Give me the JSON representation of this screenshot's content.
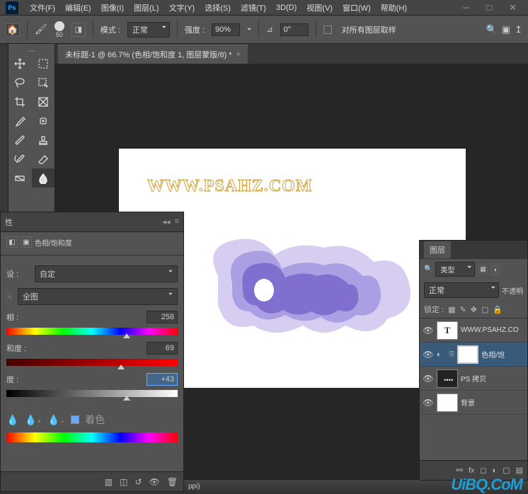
{
  "menu": {
    "file": "文件(F)",
    "edit": "编辑(E)",
    "image": "图像(I)",
    "layer": "图层(L)",
    "type": "文字(Y)",
    "select": "选择(S)",
    "filter": "滤镜(T)",
    "threeD": "3D(D)",
    "view": "视图(V)",
    "window": "窗口(W)",
    "help": "帮助(H)"
  },
  "options": {
    "brushSize": "50",
    "mode_lbl": "模式 :",
    "mode": "正常",
    "strength_lbl": "强度 :",
    "strength": "90%",
    "angle": "0°",
    "sample_all": "对所有图层取样"
  },
  "doc": {
    "tab": "未标题-1 @ 66.7% (色相/饱和度 1, 图层蒙版/8) *"
  },
  "canvas": {
    "watermark": "WWW.PSAHZ.COM"
  },
  "prop": {
    "title": "性",
    "adj_title": "色相/饱和度",
    "preset_lbl": "设 :",
    "preset": "自定",
    "range": "全图",
    "hue_lbl": "相 :",
    "hue_val": "258",
    "sat_lbl": "和度 :",
    "sat_val": "69",
    "light_lbl": "度 :",
    "light_val": "+43",
    "colorize": "着色"
  },
  "layers": {
    "title": "图层",
    "type_filter": "类型",
    "blend": "正常",
    "opacity_lbl": "不透明",
    "lock_lbl": "锁定 :",
    "items": [
      {
        "name": "WWW.PSAHZ.CO",
        "type": "T"
      },
      {
        "name": "色相/饱",
        "type": "adj"
      },
      {
        "name": "PS 拷贝",
        "type": "img"
      },
      {
        "name": "背景",
        "type": "bg"
      }
    ]
  },
  "status": {
    "ppi": "ppi)"
  },
  "brand": "UiBQ.CoM"
}
